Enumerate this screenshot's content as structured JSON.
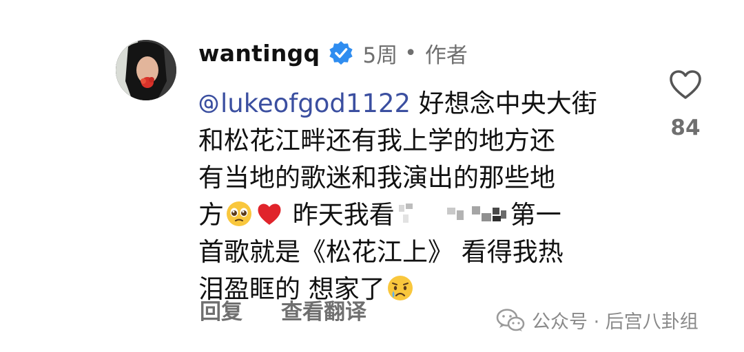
{
  "comment": {
    "username": "wantingq",
    "time": "5周",
    "separator": "•",
    "author_tag": "作者",
    "mention": "lukeofgod1122",
    "text_line1": " 好想念中央大街",
    "text_line2": "和松花江畔还有我上学的地方还",
    "text_line3": "有当地的歌迷和我演出的那些地",
    "text_line4_a": "方",
    "text_line4_b": " 昨天我看",
    "text_line4_c": "第一",
    "text_line5": "首歌就是《松花江上》 看得我热",
    "text_line6": "泪盈眶的 想家了",
    "emojis": [
      "pleading-face-emoji",
      "red-heart-emoji",
      "crying-face-emoji"
    ]
  },
  "actions": {
    "reply": "回复",
    "translate": "查看翻译"
  },
  "like": {
    "icon": "heart-outline-icon",
    "count": "84"
  },
  "watermark": {
    "text": "公众号 · 后宫八卦组",
    "icon": "wechat-icon"
  },
  "colors": {
    "mention": "#3b4fa0",
    "verified": "#2f8df0",
    "secondary_text": "#6f6f6f"
  }
}
